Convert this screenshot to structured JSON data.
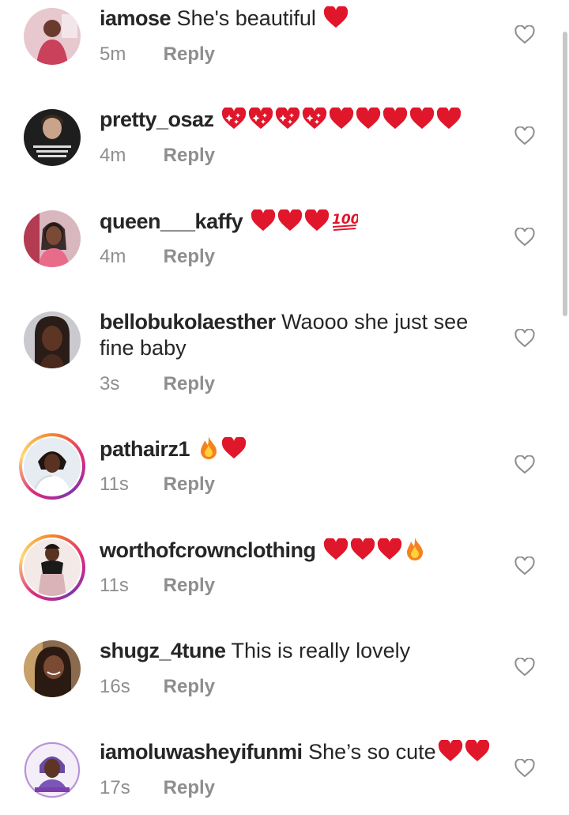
{
  "comments": [
    {
      "username": "iamose",
      "text": "She's beautiful",
      "emojis": [
        "heart"
      ],
      "time": "5m",
      "reply": "Reply"
    },
    {
      "username": "pretty_osaz",
      "text": "",
      "emojis": [
        "sparkle-heart",
        "sparkle-heart",
        "sparkle-heart",
        "sparkle-heart",
        "heart",
        "heart",
        "heart",
        "heart",
        "heart"
      ],
      "time": "4m",
      "reply": "Reply"
    },
    {
      "username": "queen___kaffy",
      "text": "",
      "emojis": [
        "heart",
        "heart",
        "heart",
        "hundred"
      ],
      "time": "4m",
      "reply": "Reply"
    },
    {
      "username": "bellobukolaesther",
      "text": "Waooo she just see fine baby",
      "emojis": [],
      "time": "3s",
      "reply": "Reply"
    },
    {
      "username": "pathairz1",
      "text": "",
      "emojis": [
        "fire",
        "heart"
      ],
      "time": "11s",
      "reply": "Reply"
    },
    {
      "username": "worthofcrownclothing",
      "text": "",
      "emojis": [
        "heart",
        "heart",
        "heart",
        "fire"
      ],
      "time": "11s",
      "reply": "Reply"
    },
    {
      "username": "shugz_4tune",
      "text": "This is really lovely",
      "emojis": [],
      "time": "16s",
      "reply": "Reply"
    },
    {
      "username": "iamoluwasheyifunmi",
      "text": "She’s so cute",
      "emojis": [
        "heart",
        "heart"
      ],
      "time": "17s",
      "reply": "Reply"
    }
  ],
  "icons": {
    "like": "heart-outline-icon",
    "avatar": "avatar-photo"
  },
  "colors": {
    "username": "#262626",
    "meta": "#8e8e8e",
    "heart": "#e0162b",
    "story_ring": "#dd2a7b"
  }
}
